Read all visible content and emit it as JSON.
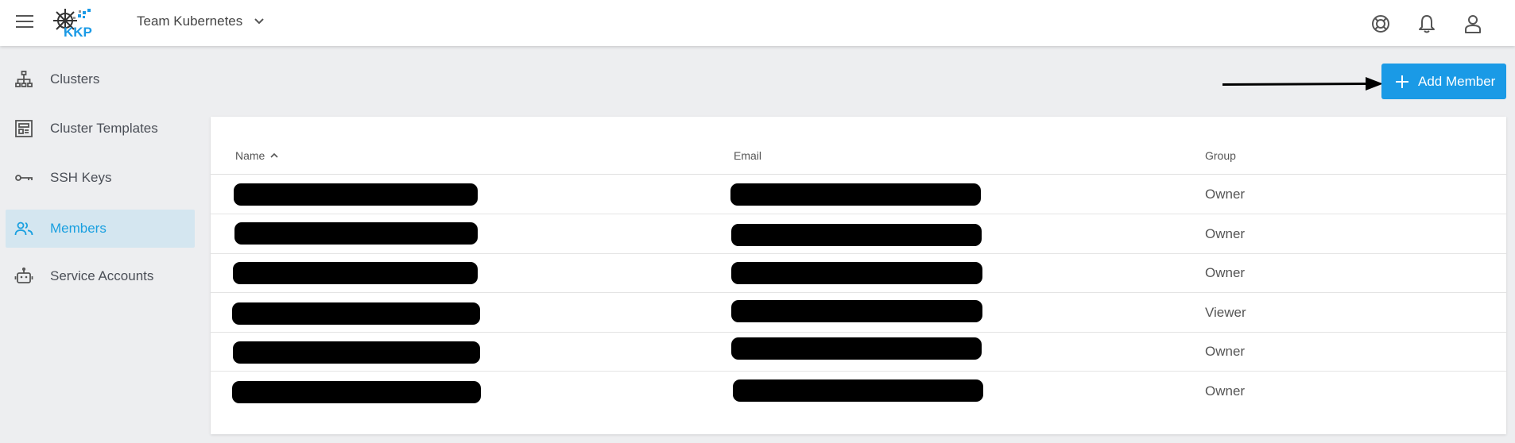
{
  "header": {
    "team_name": "Team Kubernetes",
    "logo_text": "KKP"
  },
  "sidebar": {
    "items": [
      {
        "label": "Clusters",
        "icon": "cluster-hierarchy-icon",
        "active": false
      },
      {
        "label": "Cluster Templates",
        "icon": "template-icon",
        "active": false
      },
      {
        "label": "SSH Keys",
        "icon": "key-icon",
        "active": false
      },
      {
        "label": "Members",
        "icon": "members-icon",
        "active": true
      },
      {
        "label": "Service Accounts",
        "icon": "robot-icon",
        "active": false
      }
    ]
  },
  "toolbar": {
    "add_member_label": "Add Member"
  },
  "table": {
    "columns": [
      "Name",
      "Email",
      "Group"
    ],
    "sort": {
      "column": "Name",
      "direction": "ascending"
    },
    "rows": [
      {
        "name": "[redacted]",
        "email": "[redacted]",
        "group": "Owner"
      },
      {
        "name": "[redacted]",
        "email": "[redacted]",
        "group": "Owner"
      },
      {
        "name": "[redacted]",
        "email": "[redacted]",
        "group": "Owner"
      },
      {
        "name": "[redacted]",
        "email": "[redacted]",
        "group": "Viewer"
      },
      {
        "name": "[redacted]",
        "email": "[redacted]",
        "group": "Owner"
      },
      {
        "name": "[redacted]",
        "email": "[redacted]",
        "group": "Owner"
      }
    ]
  },
  "colors": {
    "accent": "#1a9ae6",
    "active_nav_bg": "#d4e6f0",
    "background": "#edeef0"
  }
}
